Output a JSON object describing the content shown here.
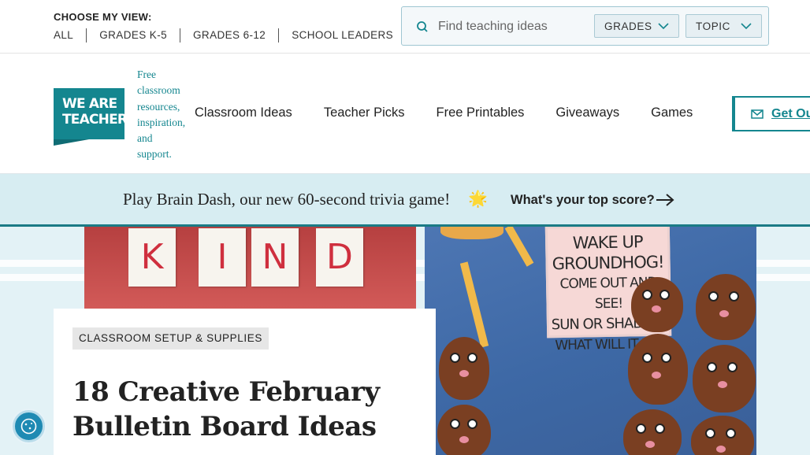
{
  "topbar": {
    "view_title": "CHOOSE MY VIEW:",
    "views": [
      "ALL",
      "GRADES K-5",
      "GRADES 6-12",
      "SCHOOL LEADERS"
    ],
    "search": {
      "placeholder": "Find teaching ideas",
      "icon": "search-icon",
      "grades_label": "GRADES",
      "topic_label": "TOPIC"
    }
  },
  "header": {
    "logo_lines": [
      "WE ARE",
      "TEACHERS"
    ],
    "tagline_lines": [
      "Free",
      "classroom",
      "resources,",
      "inspiration,",
      "and",
      "support."
    ],
    "nav": [
      "Classroom Ideas",
      "Teacher Picks",
      "Free Printables",
      "Giveaways",
      "Games"
    ],
    "cta_label": "Get Ou",
    "cta_icon": "mail-icon"
  },
  "promo": {
    "text": "Play Brain Dash, our new 60-second trivia game!",
    "star": "🌟",
    "link_label": "What's your top score?"
  },
  "hero": {
    "left_photo_letters": [
      "K",
      "I",
      "N",
      "D"
    ],
    "right_photo_sign_lines": [
      "WAKE UP",
      "GROUNDHOG!",
      "COME OUT AND SEE!",
      "SUN OR SHADOW",
      "WHAT WILL IT BE?"
    ],
    "category": "CLASSROOM SETUP & SUPPLIES",
    "headline_lines": [
      "18 Creative February",
      "Bulletin Board Ideas"
    ]
  },
  "colors": {
    "brand_teal": "#14868f",
    "promo_bg": "#d7edf2",
    "hero_bg": "#e3f2f6"
  }
}
